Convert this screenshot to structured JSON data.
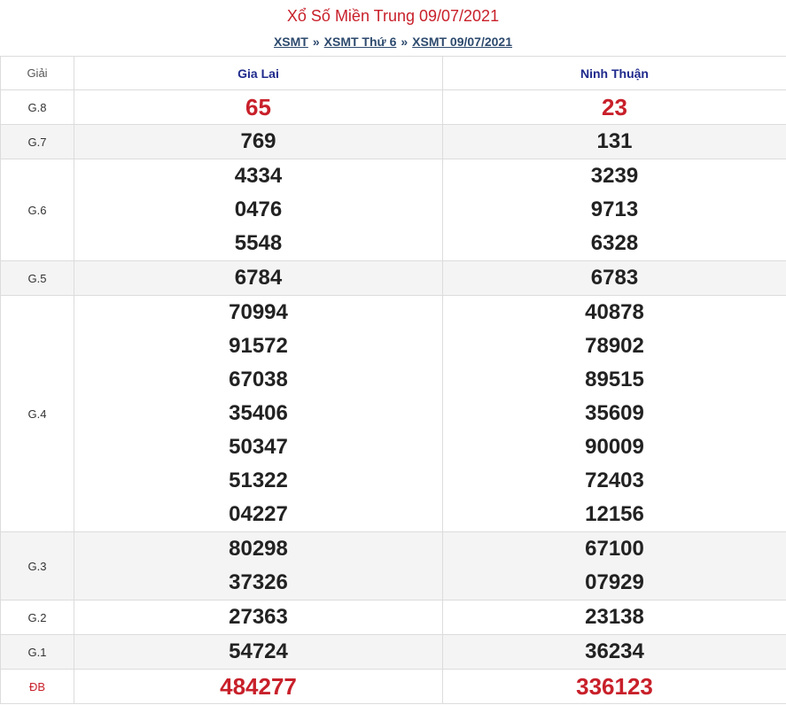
{
  "title": "Xổ Số Miền Trung 09/07/2021",
  "breadcrumb": {
    "items": [
      "XSMT",
      "XSMT Thứ 6",
      "XSMT 09/07/2021"
    ],
    "separator": "»"
  },
  "table": {
    "header_label": "Giải",
    "provinces": [
      "Gia Lai",
      "Ninh Thuận"
    ],
    "prizes": [
      {
        "label": "G.8",
        "values": [
          [
            "65"
          ],
          [
            "23"
          ]
        ],
        "highlight": true
      },
      {
        "label": "G.7",
        "values": [
          [
            "769"
          ],
          [
            "131"
          ]
        ]
      },
      {
        "label": "G.6",
        "values": [
          [
            "4334",
            "0476",
            "5548"
          ],
          [
            "3239",
            "9713",
            "6328"
          ]
        ]
      },
      {
        "label": "G.5",
        "values": [
          [
            "6784"
          ],
          [
            "6783"
          ]
        ]
      },
      {
        "label": "G.4",
        "values": [
          [
            "70994",
            "91572",
            "67038",
            "35406",
            "50347",
            "51322",
            "04227"
          ],
          [
            "40878",
            "78902",
            "89515",
            "35609",
            "90009",
            "72403",
            "12156"
          ]
        ]
      },
      {
        "label": "G.3",
        "values": [
          [
            "80298",
            "37326"
          ],
          [
            "67100",
            "07929"
          ]
        ]
      },
      {
        "label": "G.2",
        "values": [
          [
            "27363"
          ],
          [
            "23138"
          ]
        ]
      },
      {
        "label": "G.1",
        "values": [
          [
            "54724"
          ],
          [
            "36234"
          ]
        ]
      },
      {
        "label": "ĐB",
        "values": [
          [
            "484277"
          ],
          [
            "336123"
          ]
        ],
        "highlight": true,
        "special": true
      }
    ]
  },
  "colors": {
    "title": "#c8202a",
    "highlight_number": "#c8202a",
    "province_header": "#1f2a8c",
    "breadcrumb": "#2d4a6e",
    "row_shade": "#f4f4f4"
  }
}
